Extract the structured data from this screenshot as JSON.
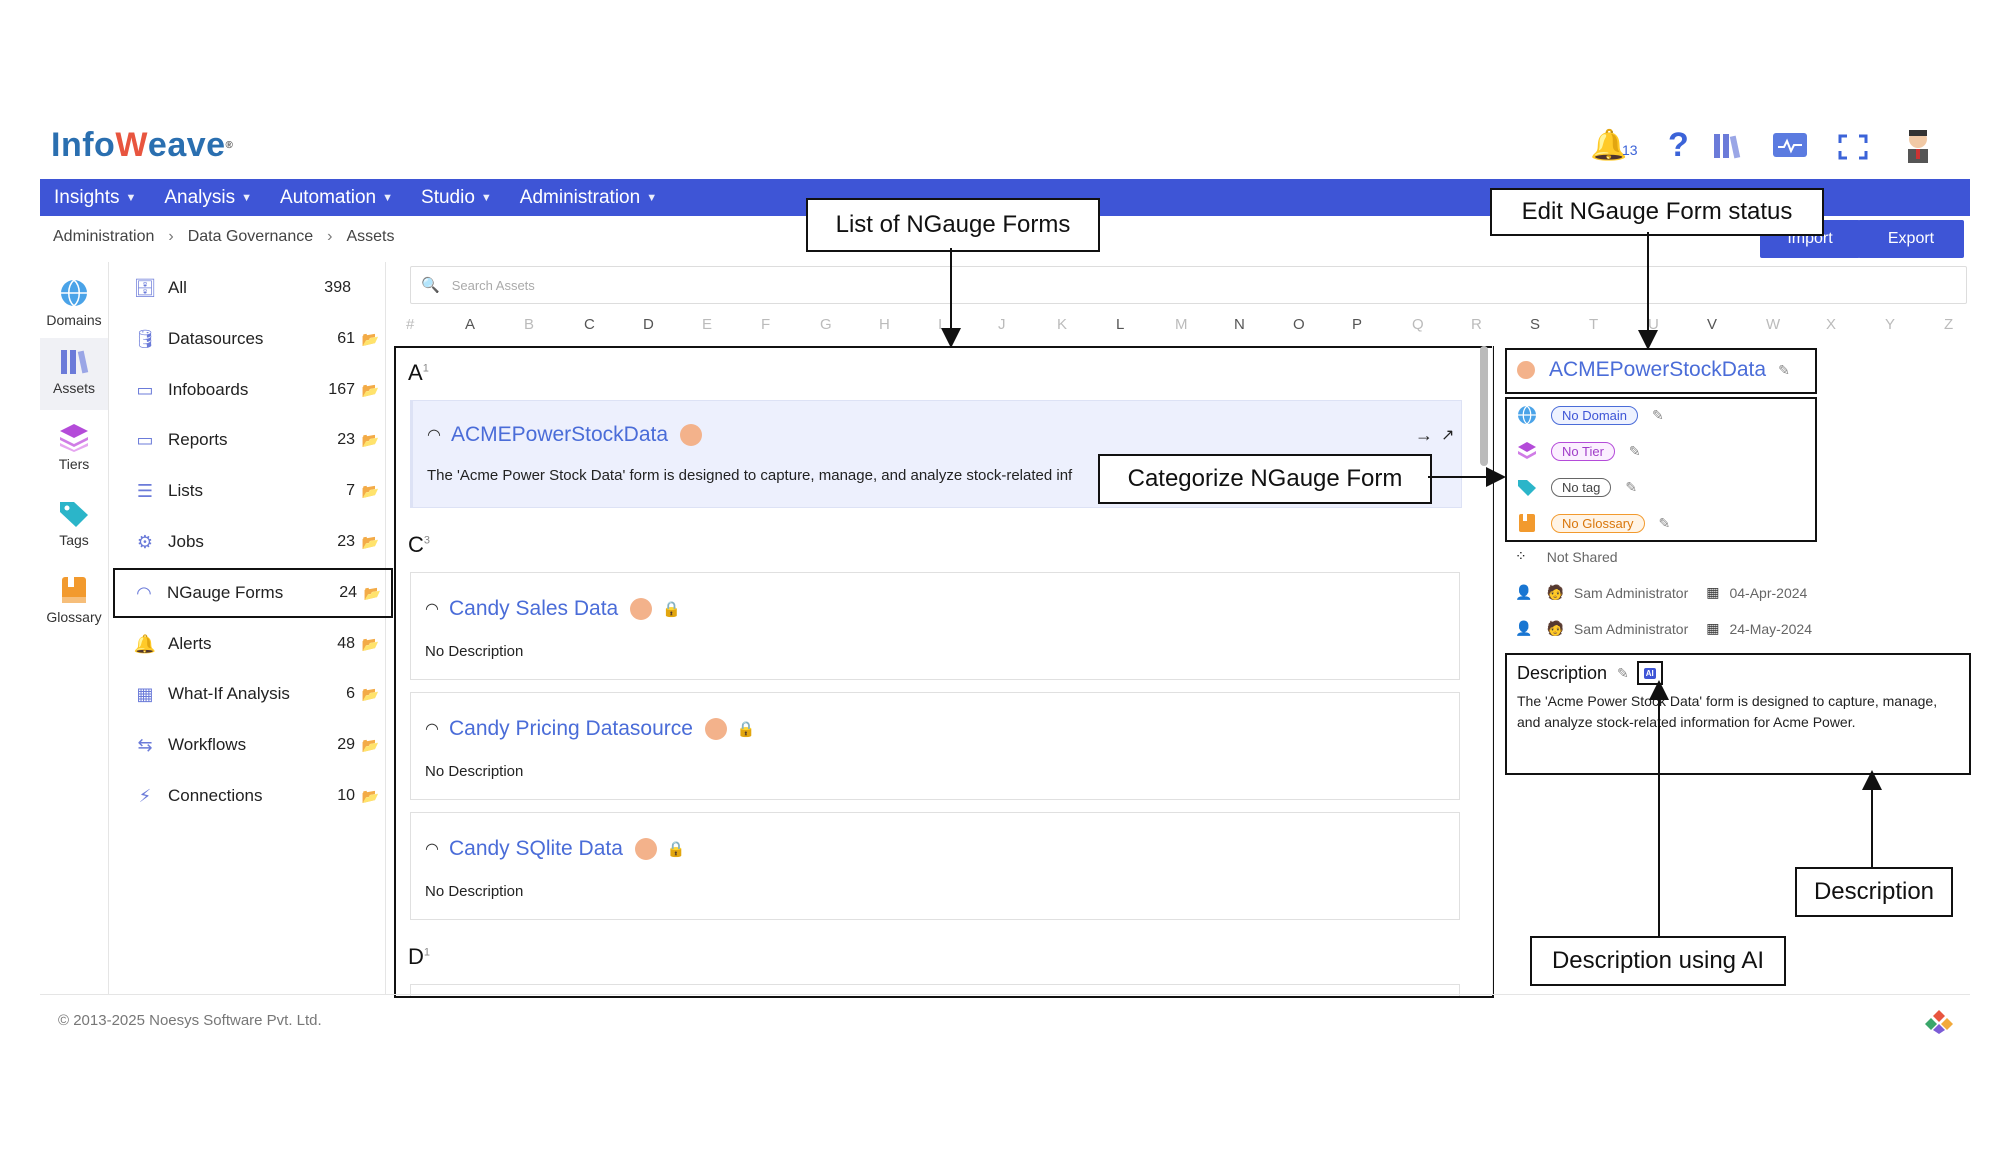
{
  "header": {
    "logo_prefix": "Info",
    "logo_mark": "W",
    "logo_suffix": "eave",
    "notification_count": "13",
    "icons": [
      "bell-icon",
      "help-icon",
      "library-icon",
      "monitor-icon",
      "fullscreen-icon",
      "user-avatar-icon"
    ]
  },
  "nav": {
    "items": [
      {
        "label": "Insights"
      },
      {
        "label": "Analysis"
      },
      {
        "label": "Automation"
      },
      {
        "label": "Studio"
      },
      {
        "label": "Administration"
      }
    ]
  },
  "breadcrumb": [
    "Administration",
    "Data Governance",
    "Assets"
  ],
  "actions": {
    "import_label": "Import",
    "export_label": "Export"
  },
  "rail": {
    "items": [
      {
        "label": "Domains",
        "icon": "globe-icon"
      },
      {
        "label": "Assets",
        "icon": "assets-icon"
      },
      {
        "label": "Tiers",
        "icon": "layers-icon"
      },
      {
        "label": "Tags",
        "icon": "tag-icon"
      },
      {
        "label": "Glossary",
        "icon": "book-icon"
      }
    ]
  },
  "asset_types": [
    {
      "label": "All",
      "count": "398"
    },
    {
      "label": "Datasources",
      "count": "61"
    },
    {
      "label": "Infoboards",
      "count": "167"
    },
    {
      "label": "Reports",
      "count": "23"
    },
    {
      "label": "Lists",
      "count": "7"
    },
    {
      "label": "Jobs",
      "count": "23"
    },
    {
      "label": "NGauge Forms",
      "count": "24"
    },
    {
      "label": "Alerts",
      "count": "48"
    },
    {
      "label": "What-If Analysis",
      "count": "6"
    },
    {
      "label": "Workflows",
      "count": "29"
    },
    {
      "label": "Connections",
      "count": "10"
    }
  ],
  "search": {
    "placeholder": "Search Assets"
  },
  "alphabet": [
    "#",
    "A",
    "B",
    "C",
    "D",
    "E",
    "F",
    "G",
    "H",
    "I",
    "J",
    "K",
    "L",
    "M",
    "N",
    "O",
    "P",
    "Q",
    "R",
    "S",
    "T",
    "U",
    "V",
    "W",
    "X",
    "Y",
    "Z"
  ],
  "groups": [
    {
      "letter": "A",
      "count": "1"
    },
    {
      "letter": "C",
      "count": "3"
    },
    {
      "letter": "D",
      "count": "1"
    }
  ],
  "forms": [
    {
      "title": "ACMEPowerStockData",
      "desc": "The 'Acme Power Stock Data' form is designed to capture, manage, and analyze stock-related inf"
    },
    {
      "title": "Candy Sales Data",
      "desc": "No Description"
    },
    {
      "title": "Candy Pricing Datasource",
      "desc": "No Description"
    },
    {
      "title": "Candy SQlite Data",
      "desc": "No Description"
    }
  ],
  "detail": {
    "title": "ACMEPowerStockData",
    "domain": "No Domain",
    "tier": "No Tier",
    "tag": "No tag",
    "glossary": "No Glossary",
    "shared": "Not Shared",
    "created_by": "Sam Administrator",
    "created_on": "04-Apr-2024",
    "modified_by": "Sam Administrator",
    "modified_on": "24-May-2024",
    "description_label": "Description",
    "ai_label": "AI",
    "description": "The 'Acme Power Stock Data' form is designed to capture, manage, and analyze stock-related information for Acme Power."
  },
  "callouts": {
    "list": "List of NGauge Forms",
    "edit_status": "Edit NGauge Form status",
    "categorize": "Categorize NGauge Form",
    "description": "Description",
    "description_ai": "Description using AI"
  },
  "footer": {
    "copyright": "© 2013-2025 Noesys Software Pvt. Ltd."
  },
  "colors": {
    "primary": "#3e55d6",
    "link": "#4a6cd8",
    "badge": "#f3b28b"
  }
}
